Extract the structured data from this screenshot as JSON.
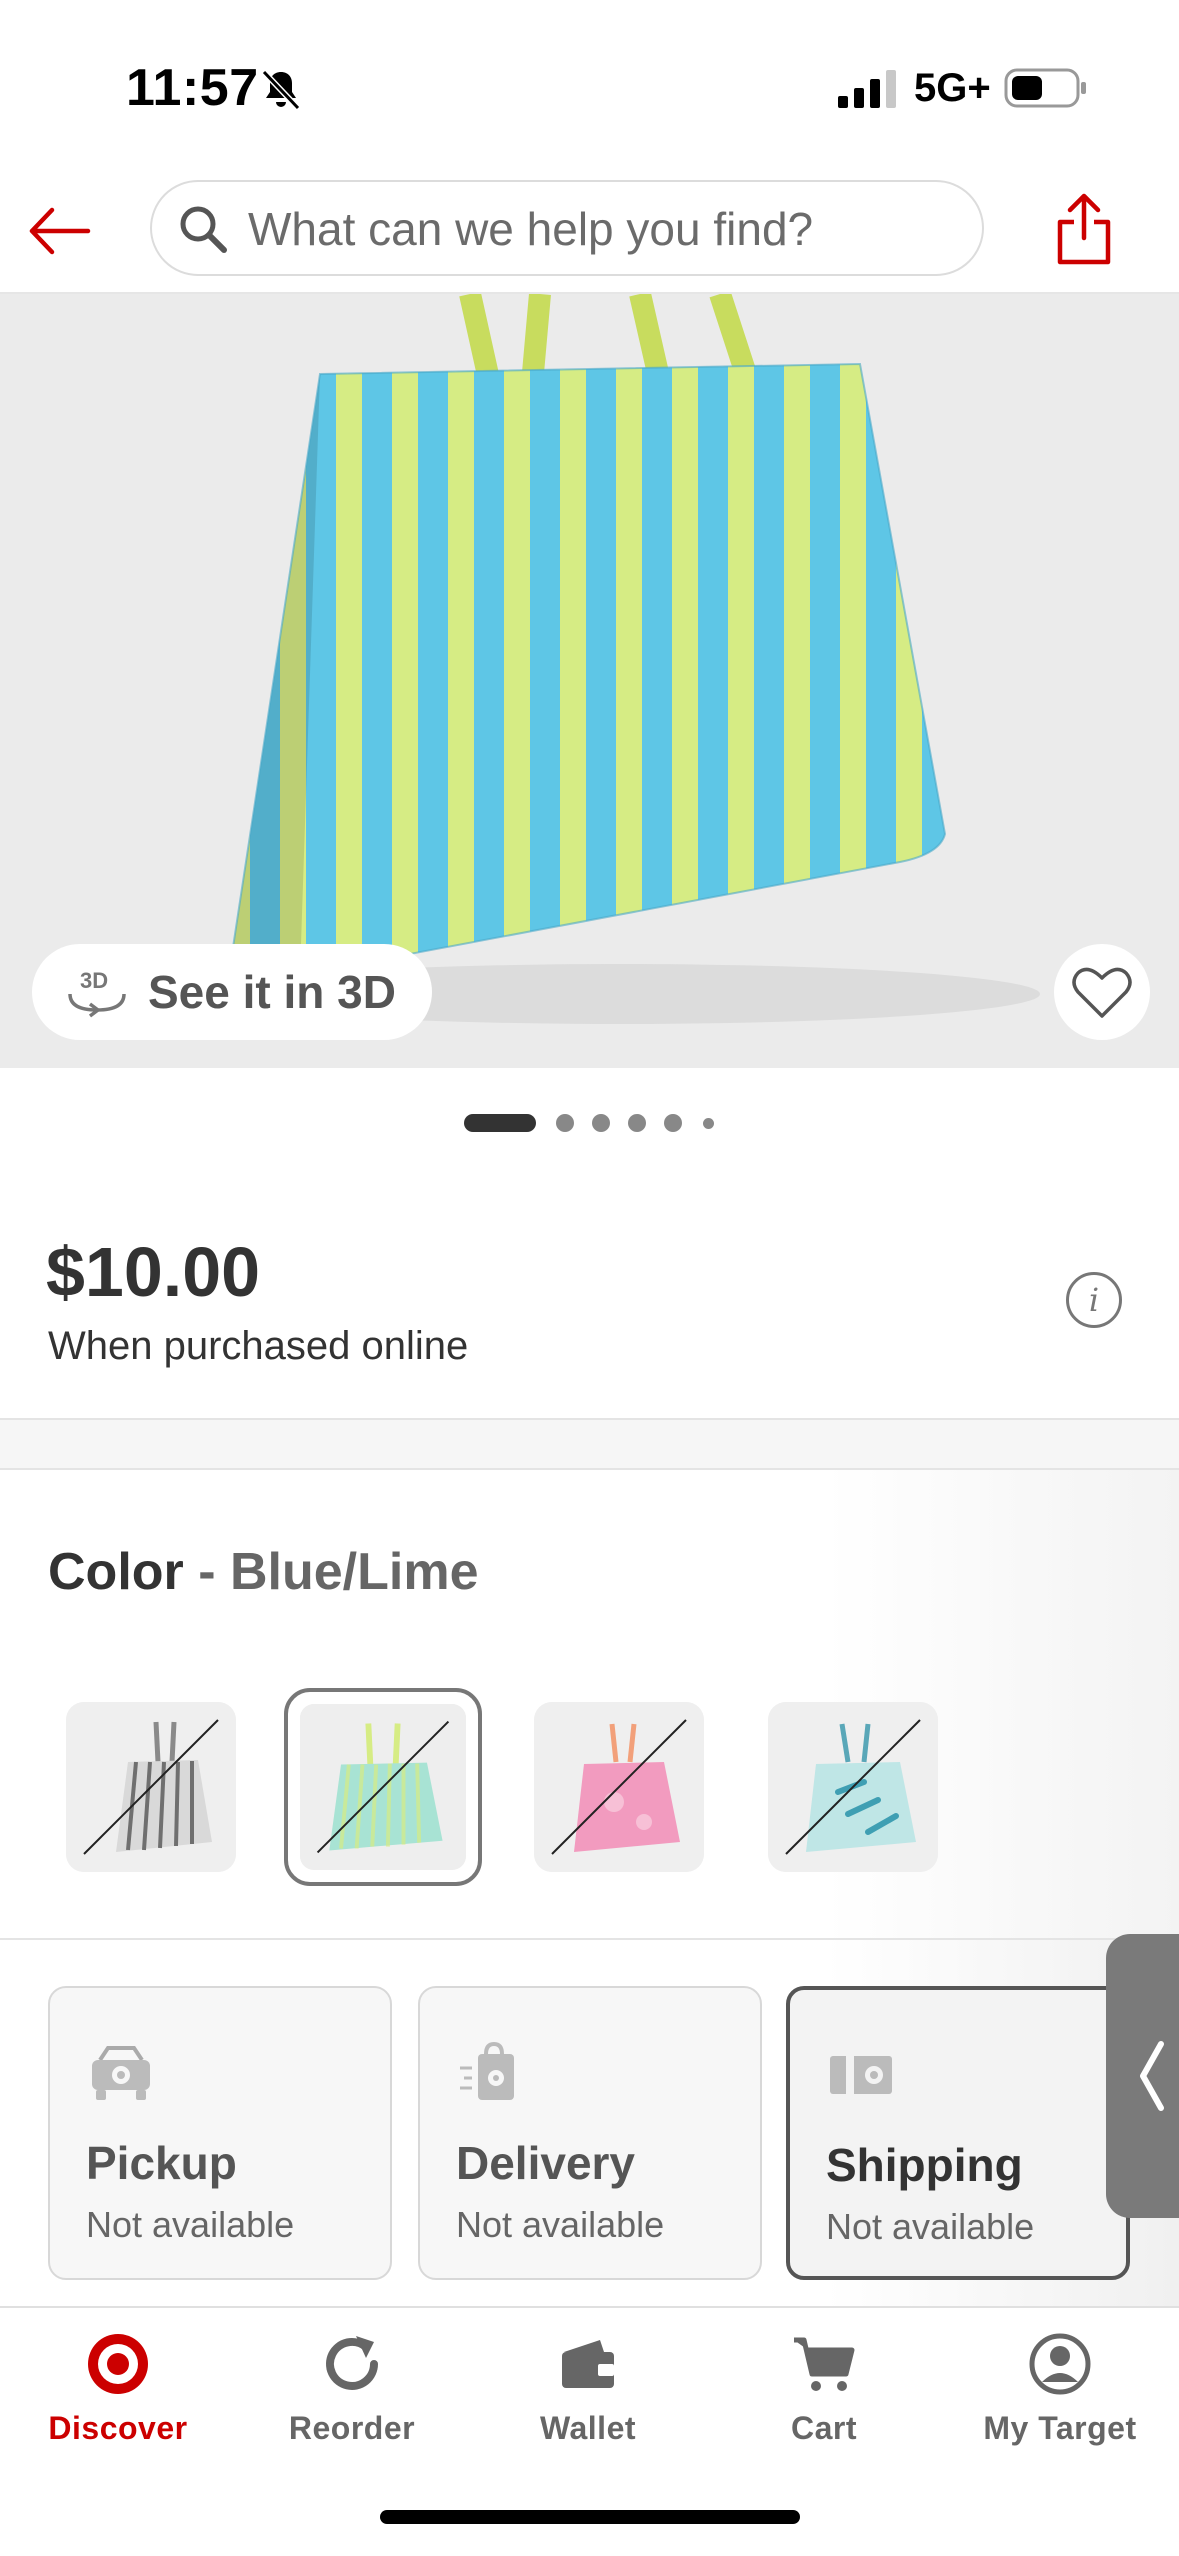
{
  "status_bar": {
    "time": "11:57",
    "network": "5G+",
    "icons": [
      "bell-slash-icon",
      "signal-icon",
      "battery-icon"
    ]
  },
  "header": {
    "search_placeholder": "What can we help you find?",
    "icons": [
      "back-arrow-icon",
      "search-icon",
      "share-icon"
    ],
    "accent_color": "#cc0000"
  },
  "hero": {
    "see_3d_label": "See it in 3D",
    "icons": [
      "3d-rotate-icon",
      "heart-icon"
    ],
    "image_count": 6,
    "active_image_index": 0
  },
  "price": {
    "amount": "$10.00",
    "note": "When purchased online",
    "icon": "info-icon"
  },
  "color": {
    "label": "Color",
    "separator": " - ",
    "value": "Blue/Lime",
    "swatches": [
      {
        "name": "gray-stripe",
        "color": "#b8b8b8",
        "available": false
      },
      {
        "name": "blue-lime",
        "color": "#a8e3d4",
        "available": false,
        "selected": true
      },
      {
        "name": "pink",
        "color": "#f29bbf",
        "available": false
      },
      {
        "name": "teal-palm",
        "color": "#8fcfd6",
        "available": false
      }
    ]
  },
  "fulfillment": {
    "options": [
      {
        "title": "Pickup",
        "status": "Not available",
        "icon": "car-icon"
      },
      {
        "title": "Delivery",
        "status": "Not available",
        "icon": "delivery-bag-icon"
      },
      {
        "title": "Shipping",
        "status": "Not available",
        "icon": "shipping-box-icon",
        "selected": true
      }
    ],
    "side_tab_icon": "chevron-left-icon"
  },
  "bottom_nav": {
    "items": [
      {
        "label": "Discover",
        "icon": "target-logo-icon",
        "active": true
      },
      {
        "label": "Reorder",
        "icon": "reorder-icon"
      },
      {
        "label": "Wallet",
        "icon": "wallet-icon"
      },
      {
        "label": "Cart",
        "icon": "cart-icon"
      },
      {
        "label": "My Target",
        "icon": "account-icon"
      }
    ]
  }
}
